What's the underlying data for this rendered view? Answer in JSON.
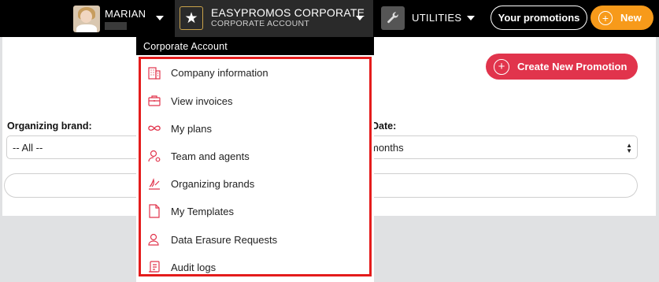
{
  "header": {
    "user": {
      "name": "MARIAN"
    },
    "corporate": {
      "title": "EASYPROMOS CORPORATE",
      "subtitle": "CORPORATE ACCOUNT",
      "icon": "star-icon"
    },
    "utilities": {
      "label": "UTILITIES",
      "icon": "wrench-icon"
    },
    "your_promotions_label": "Your promotions",
    "new_label": "New"
  },
  "main": {
    "create_label": "Create New Promotion",
    "organizing_brand_label": "Organizing brand:",
    "organizing_brand_value": "-- All --",
    "date_label": "Date:",
    "date_value": "months"
  },
  "dropdown": {
    "heading": "Corporate Account",
    "items": [
      {
        "label": "Company information",
        "icon": "building-icon"
      },
      {
        "label": "View invoices",
        "icon": "briefcase-icon"
      },
      {
        "label": "My plans",
        "icon": "infinity-icon"
      },
      {
        "label": "Team and agents",
        "icon": "user-gear-icon"
      },
      {
        "label": "Organizing brands",
        "icon": "signature-icon"
      },
      {
        "label": "My Templates",
        "icon": "document-icon"
      },
      {
        "label": "Data Erasure Requests",
        "icon": "user-erase-icon"
      },
      {
        "label": "Audit logs",
        "icon": "scroll-icon"
      }
    ]
  },
  "colors": {
    "accent_red": "#e1344c",
    "highlight_border": "#e41c1c",
    "new_orange": "#f79a1a",
    "topbar": "#000000"
  }
}
